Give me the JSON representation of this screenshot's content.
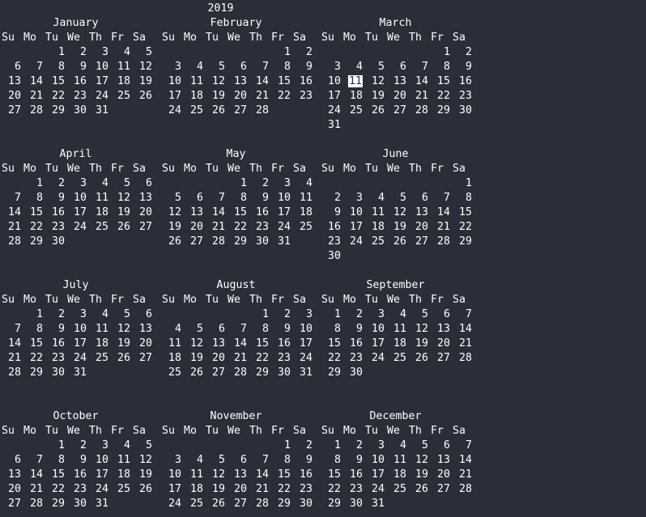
{
  "year": "2019",
  "weekday_headers": [
    "Su",
    "Mo",
    "Tu",
    "We",
    "Th",
    "Fr",
    "Sa"
  ],
  "highlighted": {
    "month_index": 2,
    "day": 11
  },
  "months": [
    {
      "name": "January",
      "first_weekday": 2,
      "days": 31
    },
    {
      "name": "February",
      "first_weekday": 5,
      "days": 28
    },
    {
      "name": "March",
      "first_weekday": 5,
      "days": 31
    },
    {
      "name": "April",
      "first_weekday": 1,
      "days": 30
    },
    {
      "name": "May",
      "first_weekday": 3,
      "days": 31
    },
    {
      "name": "June",
      "first_weekday": 6,
      "days": 30
    },
    {
      "name": "July",
      "first_weekday": 1,
      "days": 31
    },
    {
      "name": "August",
      "first_weekday": 4,
      "days": 31
    },
    {
      "name": "September",
      "first_weekday": 0,
      "days": 30
    },
    {
      "name": "October",
      "first_weekday": 2,
      "days": 31
    },
    {
      "name": "November",
      "first_weekday": 5,
      "days": 30
    },
    {
      "name": "December",
      "first_weekday": 0,
      "days": 31
    }
  ]
}
